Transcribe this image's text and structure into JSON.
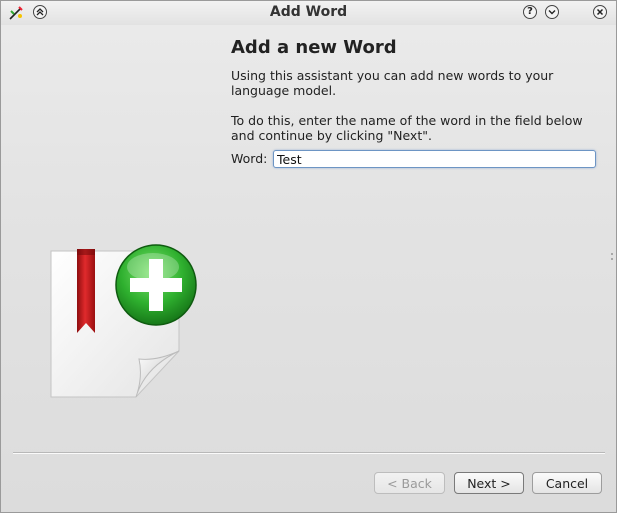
{
  "window": {
    "title": "Add Word"
  },
  "titlebar": {
    "buttons": {
      "keep_above": "keep-above-icon",
      "help": "?",
      "minimize": "chevron-down-icon",
      "close": "close-icon"
    }
  },
  "content": {
    "heading": "Add a new Word",
    "paragraph1": "Using this assistant you can add new words to your language model.",
    "paragraph2": "To do this, enter the name of the word in the field below and continue by clicking \"Next\".",
    "word_label": "Word:",
    "word_value": "Test"
  },
  "footer": {
    "back_label": "< Back",
    "next_label": "Next >",
    "cancel_label": "Cancel"
  },
  "colors": {
    "focus_border": "#6d95c4",
    "plus_green": "#2fb02f",
    "bookmark_red": "#c8191b"
  }
}
